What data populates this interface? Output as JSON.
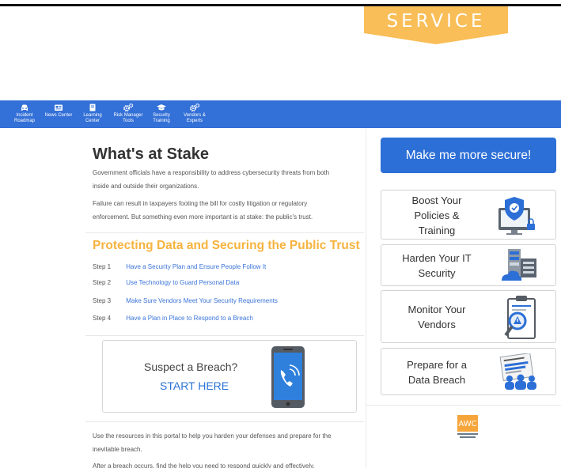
{
  "banner": {
    "text": "SERVICE",
    "color": "#f9be57"
  },
  "nav": {
    "items": [
      {
        "label": "Incident\nRoadmap",
        "icon": "car-icon"
      },
      {
        "label": "News Center",
        "icon": "newspaper-icon"
      },
      {
        "label": "Learning\nCenter",
        "icon": "book-icon"
      },
      {
        "label": "Risk Manager\nTools",
        "icon": "gears-icon"
      },
      {
        "label": "Security\nTraining",
        "icon": "graduation-cap-icon"
      },
      {
        "label": "Vendors &\nExperts",
        "icon": "gears-icon"
      }
    ],
    "color": "#3370d7"
  },
  "main": {
    "heading": "What's at Stake",
    "para1_line1": "Government officials have a responsibility to address cybersecurity threats from both",
    "para1_line2": "inside and outside their organizations.",
    "para2_line1": "Failure can result in taxpayers footing the bill for costly litigation or regulatory",
    "para2_line2": "enforcement. But something even more important is at stake: the public's trust.",
    "subheading": "Protecting Data and Securing the Public Trust",
    "steps": [
      {
        "num": "Step 1",
        "text": "Have a Security Plan and Ensure People Follow It"
      },
      {
        "num": "Step 2",
        "text": "Use Technology to Guard Personal Data"
      },
      {
        "num": "Step 3",
        "text": "Make Sure Vendors Meet Your Security Requirements"
      },
      {
        "num": "Step 4",
        "text": "Have a Plan in Place to Respond to a Breach"
      }
    ],
    "breach": {
      "title": "Suspect a Breach?",
      "link": "START HERE"
    },
    "para3_line1": "Use the resources in this portal to help you harden your defenses and prepare for the",
    "para3_line2": "inevitable breach.",
    "para4_line1": "After a breach occurs, find the help you need to respond quickly and effectively."
  },
  "sidebar": {
    "cta": "Make me more secure!",
    "cards": [
      {
        "label": "Boost Your\nPolicies &\nTraining",
        "icon": "shield-monitor-icon"
      },
      {
        "label": "Harden Your IT\nSecurity",
        "icon": "server-cloud-icon"
      },
      {
        "label": "Monitor Your\nVendors",
        "icon": "clipboard-magnifier-icon"
      },
      {
        "label": "Prepare for a\nData Breach",
        "icon": "newspaper-crowd-icon"
      }
    ],
    "logo_text": "AWC",
    "accent": "#2c6fd6"
  }
}
